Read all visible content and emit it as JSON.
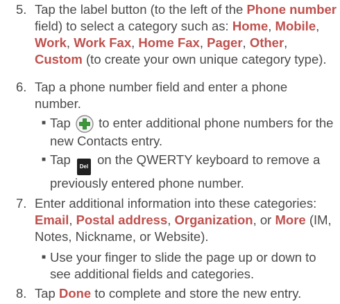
{
  "step5": {
    "num": "5.",
    "t1": "Tap the label button (to the left of the ",
    "b1": "Phone number",
    "t2": " field) to select a category such as: ",
    "c1": "Home",
    "c2": "Mobile",
    "c3": "Work",
    "c4": "Work Fax",
    "c5": "Home Fax",
    "c6": "Pager",
    "c7": "Other",
    "c8": "Custom",
    "sep": ", ",
    "t3": " (to create your own unique category type)."
  },
  "step6": {
    "num": "6.",
    "text": "Tap a phone number field and enter a phone number.",
    "bullet1_pre": "Tap",
    "bullet1_post": "to enter additional phone numbers for the new Contacts entry.",
    "bullet2_pre": "Tap",
    "del_key": "Del",
    "bullet2_post": "on the QWERTY keyboard to remove a previously entered phone number."
  },
  "step7": {
    "num": "7.",
    "t1": "Enter additional information into these categories: ",
    "c1": "Email",
    "c2": "Postal address",
    "c3": "Organization",
    "or": ", or ",
    "c4": "More",
    "t2": " (IM, Notes, Nickname, or Website).",
    "bullet": "Use your finger to slide the page up or down to see additional fields and categories."
  },
  "step8": {
    "num": "8.",
    "t1": "Tap ",
    "b1": "Done",
    "t2": " to complete and store the new entry."
  },
  "colors": {
    "highlight": "#c0504d",
    "body_text": "#4a4a4a",
    "icon_green": "#3a9a3a"
  },
  "icons": {
    "add_icon": "green-plus-circle",
    "delete_key_icon": "del-key"
  }
}
